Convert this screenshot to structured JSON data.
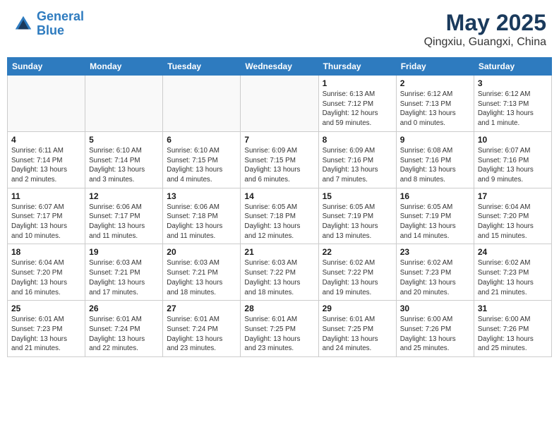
{
  "header": {
    "logo_line1": "General",
    "logo_line2": "Blue",
    "month": "May 2025",
    "location": "Qingxiu, Guangxi, China"
  },
  "days_of_week": [
    "Sunday",
    "Monday",
    "Tuesday",
    "Wednesday",
    "Thursday",
    "Friday",
    "Saturday"
  ],
  "weeks": [
    {
      "alt": false,
      "days": [
        {
          "num": "",
          "info": ""
        },
        {
          "num": "",
          "info": ""
        },
        {
          "num": "",
          "info": ""
        },
        {
          "num": "",
          "info": ""
        },
        {
          "num": "1",
          "info": "Sunrise: 6:13 AM\nSunset: 7:12 PM\nDaylight: 12 hours\nand 59 minutes."
        },
        {
          "num": "2",
          "info": "Sunrise: 6:12 AM\nSunset: 7:13 PM\nDaylight: 13 hours\nand 0 minutes."
        },
        {
          "num": "3",
          "info": "Sunrise: 6:12 AM\nSunset: 7:13 PM\nDaylight: 13 hours\nand 1 minute."
        }
      ]
    },
    {
      "alt": true,
      "days": [
        {
          "num": "4",
          "info": "Sunrise: 6:11 AM\nSunset: 7:14 PM\nDaylight: 13 hours\nand 2 minutes."
        },
        {
          "num": "5",
          "info": "Sunrise: 6:10 AM\nSunset: 7:14 PM\nDaylight: 13 hours\nand 3 minutes."
        },
        {
          "num": "6",
          "info": "Sunrise: 6:10 AM\nSunset: 7:15 PM\nDaylight: 13 hours\nand 4 minutes."
        },
        {
          "num": "7",
          "info": "Sunrise: 6:09 AM\nSunset: 7:15 PM\nDaylight: 13 hours\nand 6 minutes."
        },
        {
          "num": "8",
          "info": "Sunrise: 6:09 AM\nSunset: 7:16 PM\nDaylight: 13 hours\nand 7 minutes."
        },
        {
          "num": "9",
          "info": "Sunrise: 6:08 AM\nSunset: 7:16 PM\nDaylight: 13 hours\nand 8 minutes."
        },
        {
          "num": "10",
          "info": "Sunrise: 6:07 AM\nSunset: 7:16 PM\nDaylight: 13 hours\nand 9 minutes."
        }
      ]
    },
    {
      "alt": false,
      "days": [
        {
          "num": "11",
          "info": "Sunrise: 6:07 AM\nSunset: 7:17 PM\nDaylight: 13 hours\nand 10 minutes."
        },
        {
          "num": "12",
          "info": "Sunrise: 6:06 AM\nSunset: 7:17 PM\nDaylight: 13 hours\nand 11 minutes."
        },
        {
          "num": "13",
          "info": "Sunrise: 6:06 AM\nSunset: 7:18 PM\nDaylight: 13 hours\nand 11 minutes."
        },
        {
          "num": "14",
          "info": "Sunrise: 6:05 AM\nSunset: 7:18 PM\nDaylight: 13 hours\nand 12 minutes."
        },
        {
          "num": "15",
          "info": "Sunrise: 6:05 AM\nSunset: 7:19 PM\nDaylight: 13 hours\nand 13 minutes."
        },
        {
          "num": "16",
          "info": "Sunrise: 6:05 AM\nSunset: 7:19 PM\nDaylight: 13 hours\nand 14 minutes."
        },
        {
          "num": "17",
          "info": "Sunrise: 6:04 AM\nSunset: 7:20 PM\nDaylight: 13 hours\nand 15 minutes."
        }
      ]
    },
    {
      "alt": true,
      "days": [
        {
          "num": "18",
          "info": "Sunrise: 6:04 AM\nSunset: 7:20 PM\nDaylight: 13 hours\nand 16 minutes."
        },
        {
          "num": "19",
          "info": "Sunrise: 6:03 AM\nSunset: 7:21 PM\nDaylight: 13 hours\nand 17 minutes."
        },
        {
          "num": "20",
          "info": "Sunrise: 6:03 AM\nSunset: 7:21 PM\nDaylight: 13 hours\nand 18 minutes."
        },
        {
          "num": "21",
          "info": "Sunrise: 6:03 AM\nSunset: 7:22 PM\nDaylight: 13 hours\nand 18 minutes."
        },
        {
          "num": "22",
          "info": "Sunrise: 6:02 AM\nSunset: 7:22 PM\nDaylight: 13 hours\nand 19 minutes."
        },
        {
          "num": "23",
          "info": "Sunrise: 6:02 AM\nSunset: 7:23 PM\nDaylight: 13 hours\nand 20 minutes."
        },
        {
          "num": "24",
          "info": "Sunrise: 6:02 AM\nSunset: 7:23 PM\nDaylight: 13 hours\nand 21 minutes."
        }
      ]
    },
    {
      "alt": false,
      "days": [
        {
          "num": "25",
          "info": "Sunrise: 6:01 AM\nSunset: 7:23 PM\nDaylight: 13 hours\nand 21 minutes."
        },
        {
          "num": "26",
          "info": "Sunrise: 6:01 AM\nSunset: 7:24 PM\nDaylight: 13 hours\nand 22 minutes."
        },
        {
          "num": "27",
          "info": "Sunrise: 6:01 AM\nSunset: 7:24 PM\nDaylight: 13 hours\nand 23 minutes."
        },
        {
          "num": "28",
          "info": "Sunrise: 6:01 AM\nSunset: 7:25 PM\nDaylight: 13 hours\nand 23 minutes."
        },
        {
          "num": "29",
          "info": "Sunrise: 6:01 AM\nSunset: 7:25 PM\nDaylight: 13 hours\nand 24 minutes."
        },
        {
          "num": "30",
          "info": "Sunrise: 6:00 AM\nSunset: 7:26 PM\nDaylight: 13 hours\nand 25 minutes."
        },
        {
          "num": "31",
          "info": "Sunrise: 6:00 AM\nSunset: 7:26 PM\nDaylight: 13 hours\nand 25 minutes."
        }
      ]
    }
  ]
}
